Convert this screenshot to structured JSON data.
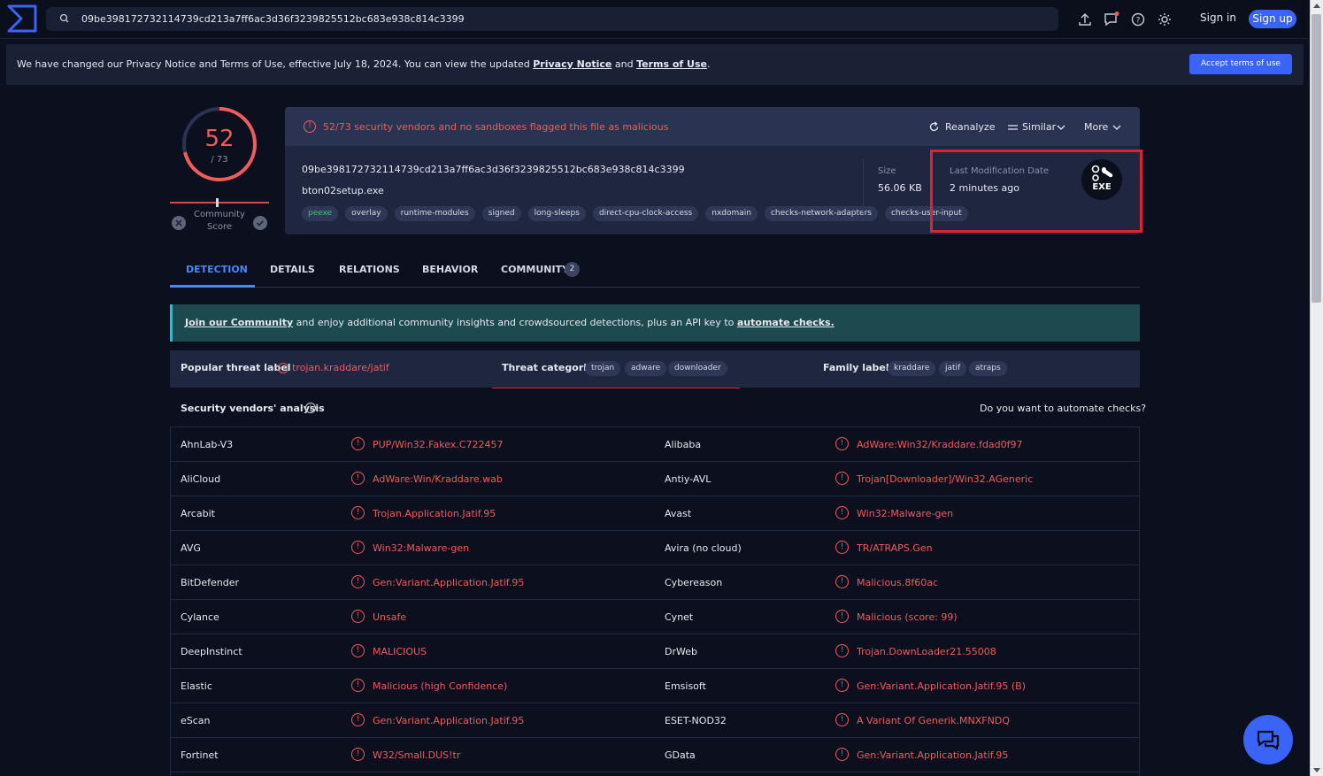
{
  "topbar": {
    "search_value": "09be398172732114739cd213a7ff6ac3d36f3239825512bc683e938c814c3399",
    "signin_label": "Sign in",
    "signup_label": "Sign up"
  },
  "banner": {
    "text_before": "We have changed our Privacy Notice and Terms of Use, effective July 18, 2024. You can view the updated ",
    "privacy_link": "Privacy Notice",
    "and_text": " and ",
    "terms_link": "Terms of Use",
    "period": ".",
    "accept_label": "Accept terms of use"
  },
  "score": {
    "detections": "52",
    "total": "/ 73",
    "detection_ratio": 0.712,
    "community_label": "Community Score"
  },
  "summary": {
    "alert": "52/73 security vendors and no sandboxes flagged this file as malicious",
    "reanalyze": "Reanalyze",
    "similar": "Similar",
    "more": "More",
    "hash": "09be398172732114739cd213a7ff6ac3d36f3239825512bc683e938c814c3399",
    "filename": "bton02setup.exe",
    "tags": [
      "peexe",
      "overlay",
      "runtime-modules",
      "signed",
      "long-sleeps",
      "direct-cpu-clock-access",
      "nxdomain",
      "checks-network-adapters",
      "checks-user-input"
    ],
    "size_label": "Size",
    "size_value": "56.06 KB",
    "lastmod_label": "Last Modification Date",
    "lastmod_value": "2 minutes ago",
    "filetype": "EXE"
  },
  "tabs": [
    {
      "label": "DETECTION"
    },
    {
      "label": "DETAILS"
    },
    {
      "label": "RELATIONS"
    },
    {
      "label": "BEHAVIOR"
    },
    {
      "label": "COMMUNITY"
    }
  ],
  "community_count": "2",
  "join": {
    "link1": "Join our Community",
    "middle": " and enjoy additional community insights and crowdsourced detections, plus an API key to ",
    "link2": "automate checks."
  },
  "labels": {
    "popular_label": "Popular threat label",
    "popular_value": "trojan.kraddare/jatif",
    "threat_cat_label": "Threat categories",
    "threat_categories": [
      "trojan",
      "adware",
      "downloader"
    ],
    "family_label": "Family labels",
    "family_labels": [
      "kraddare",
      "jatif",
      "atraps"
    ]
  },
  "analysis": {
    "title": "Security vendors' analysis",
    "automate": "Do you want to automate checks?",
    "rows": [
      {
        "v1": "AhnLab-V3",
        "r1": "PUP/Win32.Fakex.C722457",
        "v2": "Alibaba",
        "r2": "AdWare:Win32/Kraddare.fdad0f97"
      },
      {
        "v1": "AliCloud",
        "r1": "AdWare:Win/Kraddare.wab",
        "v2": "Antiy-AVL",
        "r2": "Trojan[Downloader]/Win32.AGeneric"
      },
      {
        "v1": "Arcabit",
        "r1": "Trojan.Application.Jatif.95",
        "v2": "Avast",
        "r2": "Win32:Malware-gen"
      },
      {
        "v1": "AVG",
        "r1": "Win32:Malware-gen",
        "v2": "Avira (no cloud)",
        "r2": "TR/ATRAPS.Gen"
      },
      {
        "v1": "BitDefender",
        "r1": "Gen:Variant.Application.Jatif.95",
        "v2": "Cybereason",
        "r2": "Malicious.8f60ac"
      },
      {
        "v1": "Cylance",
        "r1": "Unsafe",
        "v2": "Cynet",
        "r2": "Malicious (score: 99)"
      },
      {
        "v1": "DeepInstinct",
        "r1": "MALICIOUS",
        "v2": "DrWeb",
        "r2": "Trojan.DownLoader21.55008"
      },
      {
        "v1": "Elastic",
        "r1": "Malicious (high Confidence)",
        "v2": "Emsisoft",
        "r2": "Gen:Variant.Application.Jatif.95 (B)"
      },
      {
        "v1": "eScan",
        "r1": "Gen:Variant.Application.Jatif.95",
        "v2": "ESET-NOD32",
        "r2": "A Variant Of Generik.MNXFNDQ"
      },
      {
        "v1": "Fortinet",
        "r1": "W32/Small.DUS!tr",
        "v2": "GData",
        "r2": "Gen:Variant.Application.Jatif.95"
      }
    ]
  },
  "colors": {
    "accent": "#3a63f7",
    "malicious": "#f05b5b",
    "highlight": "#e1212b"
  }
}
